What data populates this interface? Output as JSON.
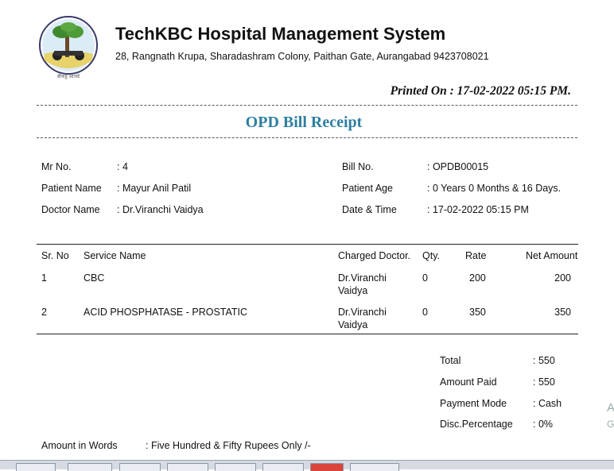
{
  "header": {
    "logo_caption": "बीकडु आजडे",
    "title": "TechKBC Hospital Management System",
    "address": "28, Rangnath Krupa, Sharadashram Colony, Paithan Gate, Aurangabad 9423708021",
    "printed_on": "Printed On : 17-02-2022 05:15 PM."
  },
  "receipt_title": "OPD Bill Receipt",
  "patient": {
    "mr_label": "Mr No.",
    "mr_value": ": 4",
    "name_label": "Patient Name",
    "name_value": ": Mayur Anil Patil",
    "doctor_label": "Doctor Name",
    "doctor_value": ": Dr.Viranchi Vaidya",
    "bill_label": "Bill No.",
    "bill_value": ": OPDB00015",
    "age_label": "Patient Age",
    "age_value": ": 0 Years 0 Months & 16 Days.",
    "date_label": "Date & Time",
    "date_value": ": 17-02-2022 05:15 PM"
  },
  "table": {
    "headers": [
      "Sr. No",
      "Service Name",
      "Charged Doctor.",
      "Qty.",
      "Rate",
      "Net Amount"
    ],
    "rows": [
      {
        "sr": "1",
        "service": "CBC",
        "doctor_line1": "Dr.Viranchi",
        "doctor_line2": "Vaidya",
        "qty": "0",
        "rate": "200",
        "net": "200"
      },
      {
        "sr": "2",
        "service": "ACID PHOSPHATASE - PROSTATIC",
        "doctor_line1": "Dr.Viranchi",
        "doctor_line2": "Vaidya",
        "qty": "0",
        "rate": "350",
        "net": "350"
      }
    ]
  },
  "totals": {
    "total_label": "Total",
    "total_value": ": 550",
    "paid_label": "Amount Paid",
    "paid_value": ": 550",
    "mode_label": "Payment Mode",
    "mode_value": ": Cash",
    "disc_label": "Disc.Percentage",
    "disc_value": ": 0%"
  },
  "amount_words": {
    "label": "Amount in Words",
    "value": ": Five Hundred & Fifty Rupees Only /-"
  },
  "edge_text": {
    "line1": "A",
    "line2": "G"
  }
}
